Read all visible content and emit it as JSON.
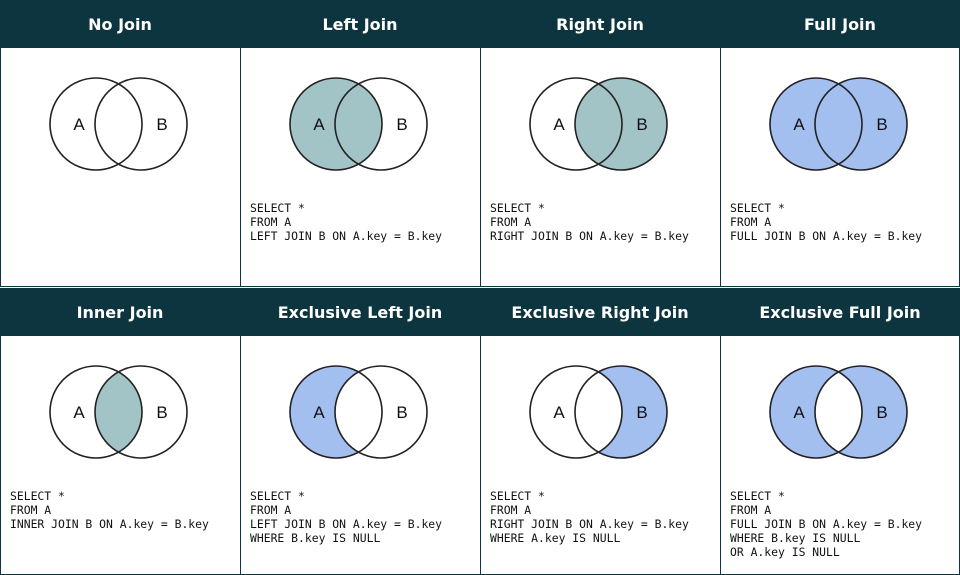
{
  "colors": {
    "header_bg": "#0d3540",
    "teal_fill": "#a3c4c7",
    "blue_fill": "#a3bff0",
    "outline": "#222222"
  },
  "panels": [
    {
      "title": "No Join",
      "fill": "none",
      "label_a": "A",
      "label_b": "B",
      "sql": []
    },
    {
      "title": "Left Join",
      "fill": "left",
      "color": "teal",
      "label_a": "A",
      "label_b": "B",
      "sql": [
        "SELECT *",
        "FROM A",
        "LEFT JOIN B ON A.key = B.key"
      ]
    },
    {
      "title": "Right Join",
      "fill": "right",
      "color": "teal",
      "label_a": "A",
      "label_b": "B",
      "sql": [
        "SELECT *",
        "FROM A",
        "RIGHT JOIN B ON A.key = B.key"
      ]
    },
    {
      "title": "Full Join",
      "fill": "full",
      "color": "blue",
      "label_a": "A",
      "label_b": "B",
      "sql": [
        "SELECT *",
        "FROM A",
        "FULL JOIN B ON A.key = B.key"
      ]
    },
    {
      "title": "Inner Join",
      "fill": "inner",
      "color": "teal",
      "label_a": "A",
      "label_b": "B",
      "sql": [
        "SELECT *",
        "FROM A",
        "INNER JOIN B ON A.key = B.key"
      ]
    },
    {
      "title": "Exclusive Left Join",
      "fill": "excl-left",
      "color": "blue",
      "label_a": "A",
      "label_b": "B",
      "sql": [
        "SELECT *",
        "FROM A",
        "LEFT JOIN B ON A.key = B.key",
        "WHERE B.key IS NULL"
      ]
    },
    {
      "title": "Exclusive Right Join",
      "fill": "excl-right",
      "color": "blue",
      "label_a": "A",
      "label_b": "B",
      "sql": [
        "SELECT *",
        "FROM A",
        "RIGHT JOIN B ON A.key = B.key",
        "WHERE A.key IS NULL"
      ]
    },
    {
      "title": "Exclusive Full Join",
      "fill": "excl-full",
      "color": "blue",
      "label_a": "A",
      "label_b": "B",
      "sql": [
        "SELECT *",
        "FROM A",
        "FULL JOIN B ON A.key = B.key",
        "WHERE B.key IS NULL",
        "OR A.key IS NULL"
      ]
    }
  ]
}
